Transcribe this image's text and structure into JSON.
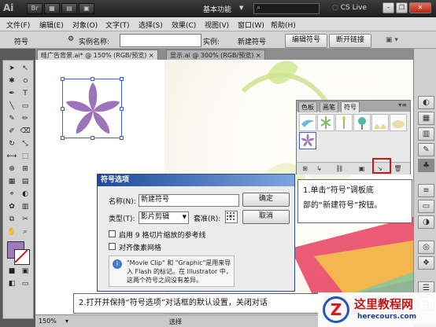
{
  "titlebar": {
    "app_logo": "Ai",
    "workspace": "基本功能",
    "cs_live": "CS Live",
    "icons": [
      "app-logo-icon",
      "bridge-icon",
      "stock-icon",
      "arrange-icon",
      "mode-icon",
      "search-icon",
      "minimize-icon",
      "restore-icon",
      "close-icon"
    ]
  },
  "menubar": {
    "items": [
      "文件(F)",
      "编辑(E)",
      "对象(O)",
      "文字(T)",
      "选择(S)",
      "效果(C)",
      "视图(V)",
      "窗口(W)",
      "帮助(H)"
    ]
  },
  "controlbar": {
    "symbol_label": "符号",
    "instance_name_label": "实例名称:",
    "instance_label": "实例:",
    "instance_value": "新建符号",
    "edit_symbol_button": "编辑符号",
    "break_link_button": "断开链接"
  },
  "tabs": {
    "doc1": "畦广告背景.ai* @ 150% (RGB/预览)",
    "doc2": "显示.ai @ 300% (RGB/预览)"
  },
  "symbols_panel": {
    "tabs": [
      "色板",
      "画笔",
      "符号"
    ],
    "active_tab": "符号"
  },
  "dialog": {
    "title": "符号选项",
    "name_label": "名称(N):",
    "name_value": "新建符号",
    "type_label": "类型(T):",
    "type_value": "影片剪辑",
    "registration_label": "套准(R):",
    "ok_button": "确定",
    "cancel_button": "取消",
    "guides_checkbox": "启用 9 格切片缩放的参考线",
    "pixel_grid_checkbox": "对齐像素网格",
    "info_text": "\"Movie Clip\" 和 \"Graphic\"是用来导入 Flash 的标记。在 Illustrator 中，这两个符号之间没有差异。"
  },
  "callouts": {
    "step1_line1": "1.单击“符号”调板底",
    "step1_line2": "部的“新建符号”按钮。",
    "step2": "2.打开并保持“符号选项”对话框的默认设置，关闭对话"
  },
  "statusbar": {
    "zoom": "150%",
    "selection": "选择"
  },
  "watermark": {
    "title": "这里教程网",
    "url": "herecours.com"
  },
  "colors": {
    "star": "#9d73ba",
    "highlight": "#d01515",
    "fill_swatch": "#a07abf"
  }
}
